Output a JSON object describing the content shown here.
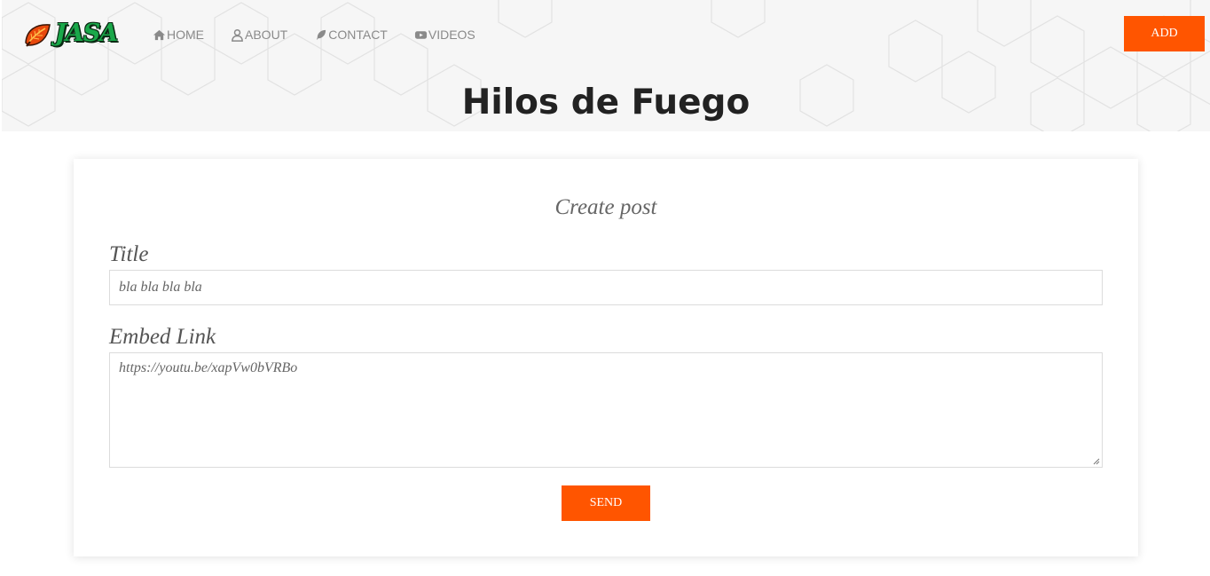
{
  "brand": {
    "logo_text": "JASA"
  },
  "nav": {
    "items": [
      {
        "label": "HOME",
        "icon": "home-icon"
      },
      {
        "label": "ABOUT",
        "icon": "user-icon"
      },
      {
        "label": "CONTACT",
        "icon": "feather-icon"
      },
      {
        "label": "VIDEOS",
        "icon": "youtube-icon"
      }
    ]
  },
  "header": {
    "add_label": "ADD",
    "page_title": "Hilos de Fuego"
  },
  "form": {
    "heading": "Create post",
    "title_label": "Title",
    "title_value": "bla bla bla bla",
    "embed_label": "Embed Link",
    "embed_value": "https://youtu.be/xapVw0bVRBo",
    "send_label": "SEND"
  },
  "colors": {
    "accent": "#ff5500",
    "nav_text": "#8a8a8a",
    "logo_green": "#1aa84a"
  }
}
